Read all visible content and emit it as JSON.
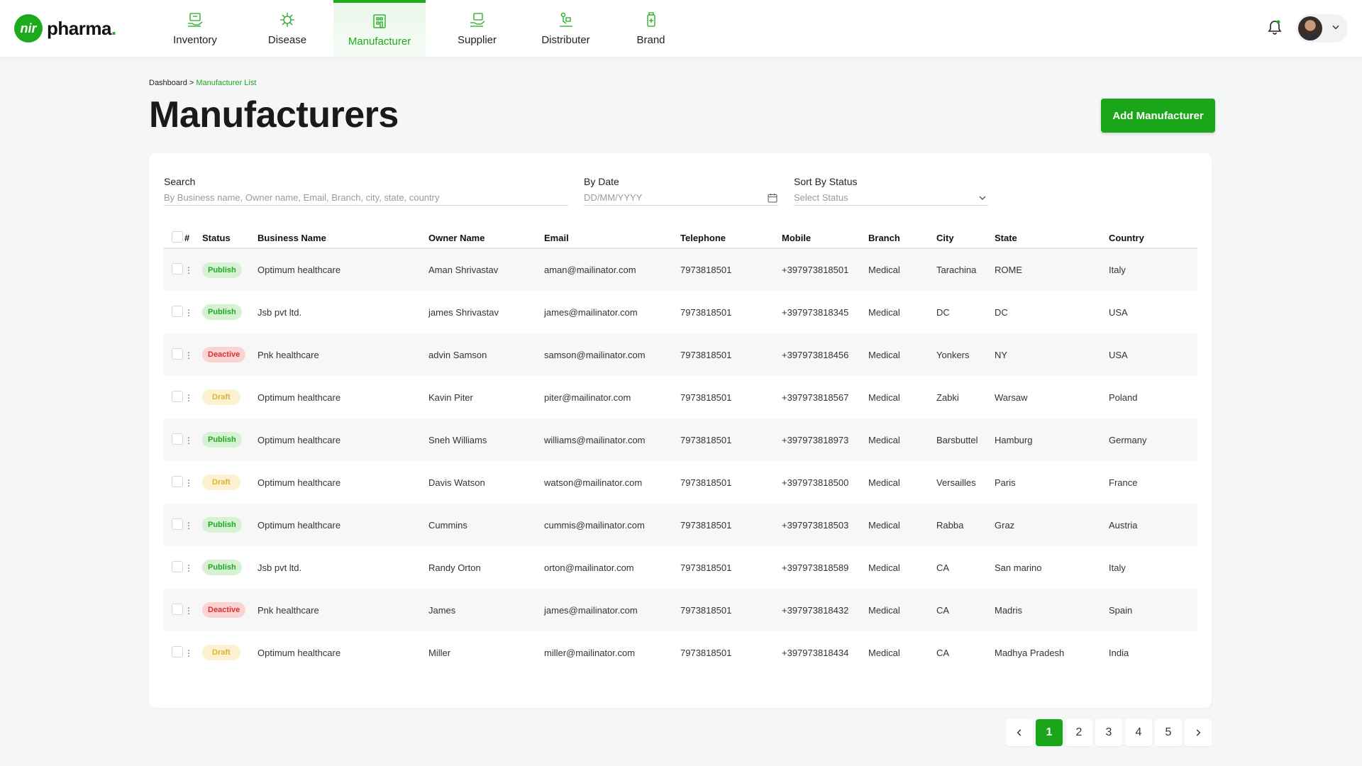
{
  "brand": {
    "logo_mark": "nir",
    "name": "pharma",
    "accent": "#1ea91e"
  },
  "nav": [
    {
      "label": "Inventory",
      "icon": "inventory-icon",
      "active": false
    },
    {
      "label": "Disease",
      "icon": "disease-icon",
      "active": false
    },
    {
      "label": "Manufacturer",
      "icon": "manufacturer-icon",
      "active": true
    },
    {
      "label": "Supplier",
      "icon": "supplier-icon",
      "active": false
    },
    {
      "label": "Distributer",
      "icon": "distributer-icon",
      "active": false
    },
    {
      "label": "Brand",
      "icon": "brand-icon",
      "active": false
    }
  ],
  "breadcrumb": {
    "root": "Dashboard",
    "separator": ">",
    "current": "Manufacturer List"
  },
  "page": {
    "title": "Manufacturers",
    "add_button": "Add Manufacturer"
  },
  "filters": {
    "search": {
      "label": "Search",
      "placeholder": "By Business name, Owner name, Email, Branch, city, state, country"
    },
    "date": {
      "label": "By Date",
      "placeholder": "DD/MM/YYYY"
    },
    "status": {
      "label": "Sort By  Status",
      "placeholder": "Select Status"
    }
  },
  "table": {
    "columns": [
      "#",
      "Status",
      "Business Name",
      "Owner Name",
      "Email",
      "Telephone",
      "Mobile",
      "Branch",
      "City",
      "State",
      "Country"
    ],
    "rows": [
      {
        "status": "Publish",
        "business": "Optimum healthcare",
        "owner": "Aman Shrivastav",
        "email": "aman@mailinator.com",
        "telephone": "7973818501",
        "mobile": "+397973818501",
        "branch": "Medical",
        "city": "Tarachina",
        "state": "ROME",
        "country": "Italy"
      },
      {
        "status": "Publish",
        "business": "Jsb pvt ltd.",
        "owner": "james Shrivastav",
        "email": "james@mailinator.com",
        "telephone": "7973818501",
        "mobile": "+397973818345",
        "branch": "Medical",
        "city": "DC",
        "state": "DC",
        "country": "USA"
      },
      {
        "status": "Deactive",
        "business": "Pnk healthcare",
        "owner": "advin Samson",
        "email": "samson@mailinator.com",
        "telephone": "7973818501",
        "mobile": "+397973818456",
        "branch": "Medical",
        "city": "Yonkers",
        "state": "NY",
        "country": "USA"
      },
      {
        "status": "Draft",
        "business": "Optimum healthcare",
        "owner": "Kavin Piter",
        "email": "piter@mailinator.com",
        "telephone": "7973818501",
        "mobile": "+397973818567",
        "branch": "Medical",
        "city": "Zabki",
        "state": "Warsaw",
        "country": "Poland"
      },
      {
        "status": "Publish",
        "business": "Optimum healthcare",
        "owner": "Sneh Williams",
        "email": "williams@mailinator.com",
        "telephone": "7973818501",
        "mobile": "+397973818973",
        "branch": "Medical",
        "city": "Barsbuttel",
        "state": "Hamburg",
        "country": "Germany"
      },
      {
        "status": "Draft",
        "business": "Optimum healthcare",
        "owner": "Davis Watson",
        "email": "watson@mailinator.com",
        "telephone": "7973818501",
        "mobile": "+397973818500",
        "branch": "Medical",
        "city": "Versailles",
        "state": "Paris",
        "country": "France"
      },
      {
        "status": "Publish",
        "business": "Optimum healthcare",
        "owner": "Cummins",
        "email": "cummis@mailinator.com",
        "telephone": "7973818501",
        "mobile": "+397973818503",
        "branch": "Medical",
        "city": "Rabba",
        "state": "Graz",
        "country": "Austria"
      },
      {
        "status": "Publish",
        "business": "Jsb pvt ltd.",
        "owner": "Randy Orton",
        "email": "orton@mailinator.com",
        "telephone": "7973818501",
        "mobile": "+397973818589",
        "branch": "Medical",
        "city": "CA",
        "state": "San marino",
        "country": "Italy"
      },
      {
        "status": "Deactive",
        "business": "Pnk healthcare",
        "owner": "James",
        "email": "james@mailinator.com",
        "telephone": "7973818501",
        "mobile": "+397973818432",
        "branch": "Medical",
        "city": "CA",
        "state": "Madris",
        "country": "Spain"
      },
      {
        "status": "Draft",
        "business": "Optimum healthcare",
        "owner": "Miller",
        "email": "miller@mailinator.com",
        "telephone": "7973818501",
        "mobile": "+397973818434",
        "branch": "Medical",
        "city": "CA",
        "state": "Madhya Pradesh",
        "country": "India"
      }
    ]
  },
  "pagination": {
    "pages": [
      "1",
      "2",
      "3",
      "4",
      "5"
    ],
    "current": "1"
  },
  "colors": {
    "publish": "#1ea91e",
    "deactive": "#d92f2f",
    "draft": "#e2b23a"
  }
}
